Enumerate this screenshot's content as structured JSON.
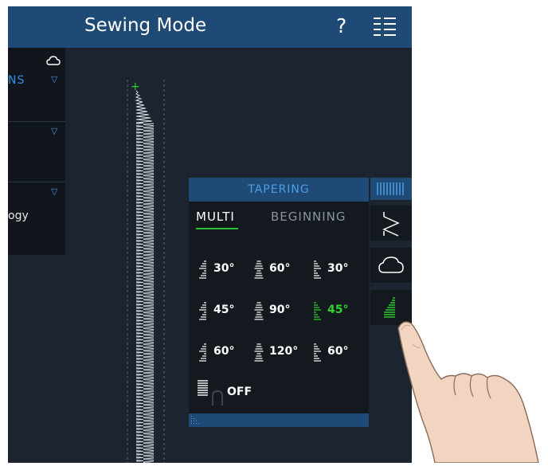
{
  "header": {
    "title": "Sewing Mode",
    "help_symbol": "?",
    "menu_icon": "menu-list-icon"
  },
  "left_panel": {
    "row1_text": "NS",
    "row3_text": "ogy",
    "cloud_icon": "cloud-icon"
  },
  "tapering": {
    "title": "TAPERING",
    "tabs": [
      {
        "label": "MULTI",
        "active": true
      },
      {
        "label": "BEGINNING",
        "active": false
      }
    ],
    "options": [
      {
        "label": "30°",
        "selected": false
      },
      {
        "label": "60°",
        "selected": false
      },
      {
        "label": "30°",
        "selected": false
      },
      {
        "label": "45°",
        "selected": false
      },
      {
        "label": "90°",
        "selected": false
      },
      {
        "label": "45°",
        "selected": true
      },
      {
        "label": "60°",
        "selected": false
      },
      {
        "label": "120°",
        "selected": false
      },
      {
        "label": "60°",
        "selected": false
      }
    ],
    "off_label": "OFF"
  },
  "sidebar": [
    {
      "icon": "stitch-columns-icon",
      "active": true
    },
    {
      "icon": "zigzag-stitch-icon",
      "active": false
    },
    {
      "icon": "cloud-icon",
      "active": false
    },
    {
      "icon": "tapering-icon",
      "active": false
    }
  ],
  "colors": {
    "accent_blue": "#1f4a75",
    "selected_green": "#2fd42f",
    "background": "#1c2430"
  }
}
